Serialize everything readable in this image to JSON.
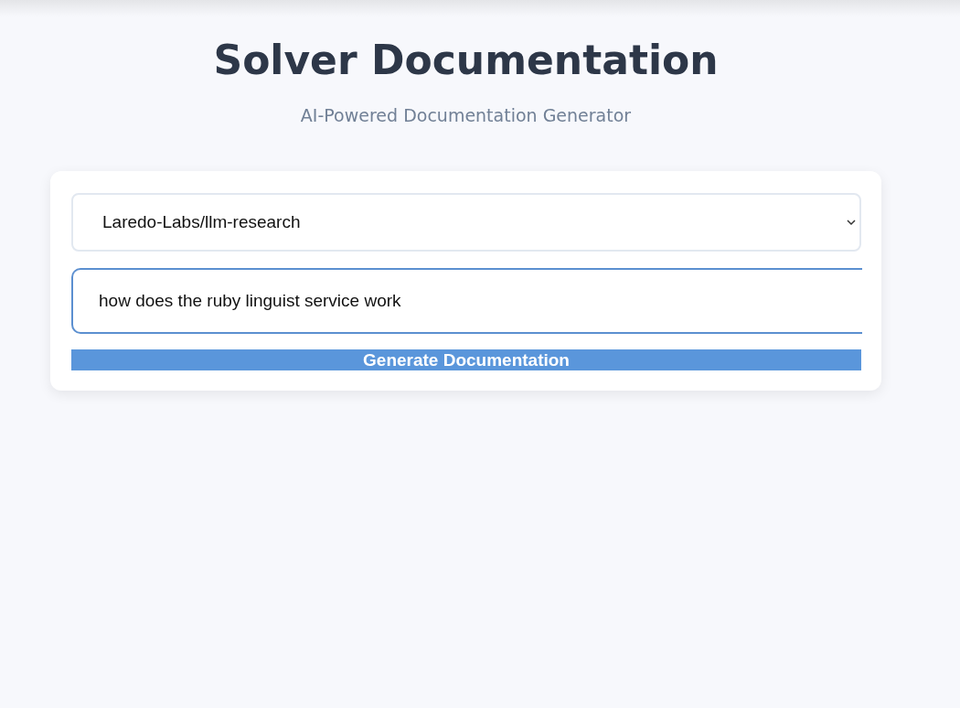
{
  "header": {
    "title": "Solver Documentation",
    "subtitle": "AI-Powered Documentation Generator"
  },
  "form": {
    "repository": {
      "value": "Laredo-Labs/llm-research"
    },
    "question": {
      "value": "how does the ruby linguist service work",
      "focused": true
    },
    "button": {
      "label": "Generate Documentation"
    }
  }
}
